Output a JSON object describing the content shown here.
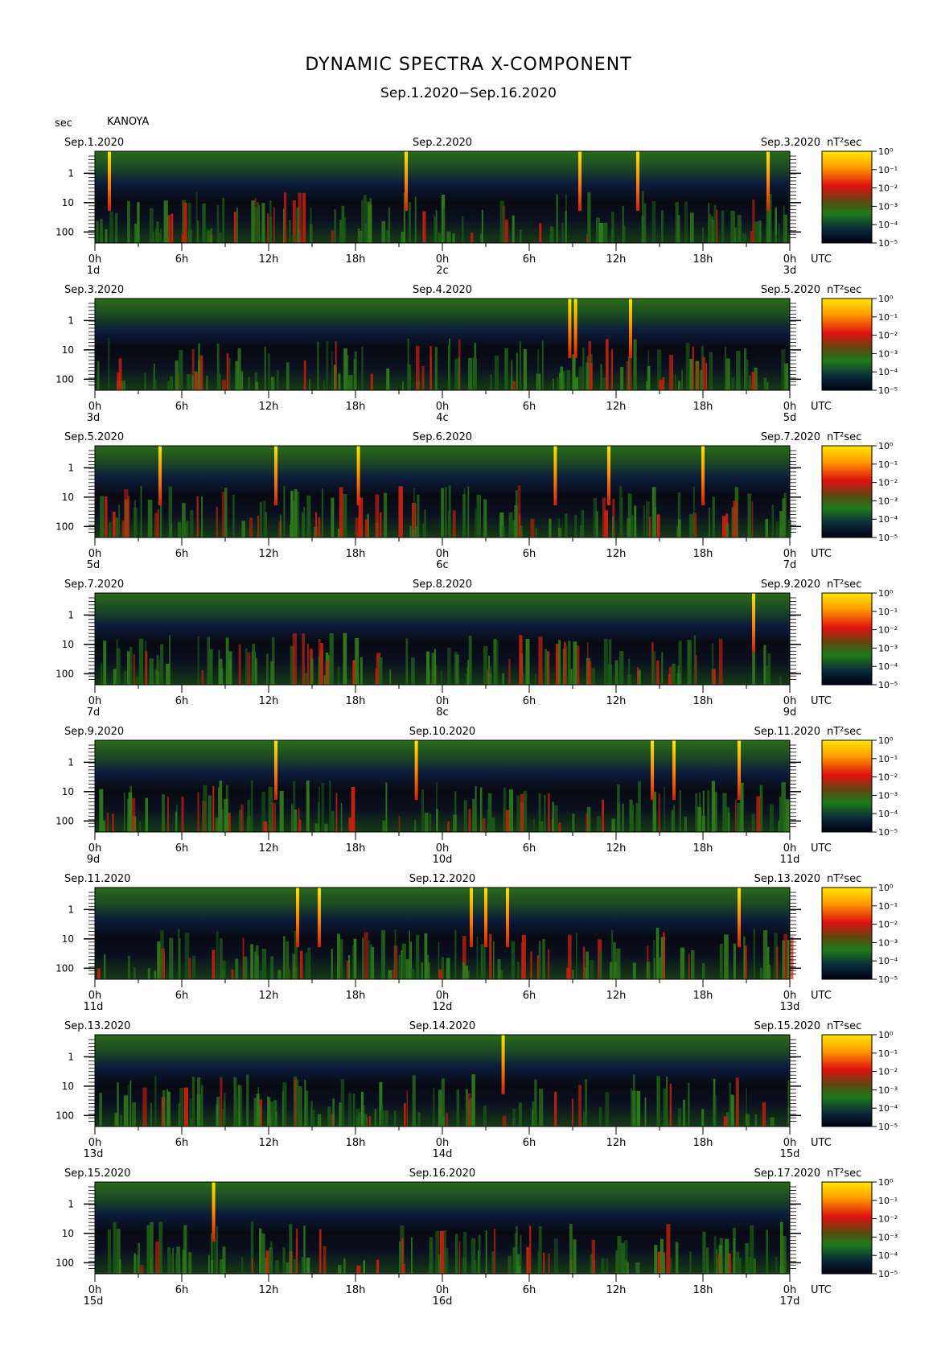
{
  "title": "DYNAMIC SPECTRA X-COMPONENT",
  "subtitle": "Sep.1.2020−Sep.16.2020",
  "y_unit": "sec",
  "station": "KANOYA",
  "colorbar_unit": "nT²sec",
  "colorbar_ticks": [
    "10⁰",
    "10⁻¹",
    "10⁻²",
    "10⁻³",
    "10⁻⁴",
    "10⁻⁵"
  ],
  "colors": {
    "background": "#0a0c14",
    "low": "#0b1a3a",
    "mid": "#1f5a14",
    "high": "#e01a0a",
    "peak": "#ffe600"
  },
  "chart_data": {
    "type": "heatmap",
    "title": "DYNAMIC SPECTRA X-COMPONENT",
    "subtitle": "Sep.1.2020−Sep.16.2020",
    "ylabel": "sec",
    "y_scale": "log",
    "y_ticks": [
      "1",
      "10",
      "100"
    ],
    "x_ticks": [
      "0h",
      "6h",
      "12h",
      "18h",
      "0h",
      "6h",
      "12h",
      "18h",
      "0h"
    ],
    "x_unit_label": "UTC",
    "colorbar": {
      "label": "nT²sec",
      "scale": "log",
      "range": [
        "10⁻⁵",
        "10⁰"
      ]
    },
    "panels": [
      {
        "start": "Sep.1.2020",
        "mid": "Sep.2.2020",
        "end": "Sep.3.2020",
        "d0": "1d",
        "d1": "2c",
        "d2": "3d",
        "spikes_hours": [
          1,
          21.5,
          33.5,
          37.5,
          46.5
        ]
      },
      {
        "start": "Sep.3.2020",
        "mid": "Sep.4.2020",
        "end": "Sep.5.2020",
        "d0": "3d",
        "d1": "4c",
        "d2": "5d",
        "spikes_hours": [
          32.8,
          33.2,
          37.0
        ]
      },
      {
        "start": "Sep.5.2020",
        "mid": "Sep.6.2020",
        "end": "Sep.7.2020",
        "d0": "5d",
        "d1": "6c",
        "d2": "7d",
        "spikes_hours": [
          4.5,
          12.5,
          18.2,
          31.8,
          35.5,
          42
        ]
      },
      {
        "start": "Sep.7.2020",
        "mid": "Sep.8.2020",
        "end": "Sep.9.2020",
        "d0": "7d",
        "d1": "8c",
        "d2": "9d",
        "spikes_hours": [
          45.5
        ]
      },
      {
        "start": "Sep.9.2020",
        "mid": "Sep.10.2020",
        "end": "Sep.11.2020",
        "d0": "9d",
        "d1": "10d",
        "d2": "11d",
        "spikes_hours": [
          12.5,
          22.2,
          38.5,
          40,
          44.5
        ]
      },
      {
        "start": "Sep.11.2020",
        "mid": "Sep.12.2020",
        "end": "Sep.13.2020",
        "d0": "11d",
        "d1": "12d",
        "d2": "13d",
        "spikes_hours": [
          14,
          15.5,
          26,
          27,
          28.5,
          44.5
        ]
      },
      {
        "start": "Sep.13.2020",
        "mid": "Sep.14.2020",
        "end": "Sep.15.2020",
        "d0": "13d",
        "d1": "14d",
        "d2": "15d",
        "spikes_hours": [
          28.2
        ]
      },
      {
        "start": "Sep.15.2020",
        "mid": "Sep.16.2020",
        "end": "Sep.17.2020",
        "d0": "15d",
        "d1": "16d",
        "d2": "17d",
        "spikes_hours": [
          8.2
        ]
      }
    ]
  }
}
